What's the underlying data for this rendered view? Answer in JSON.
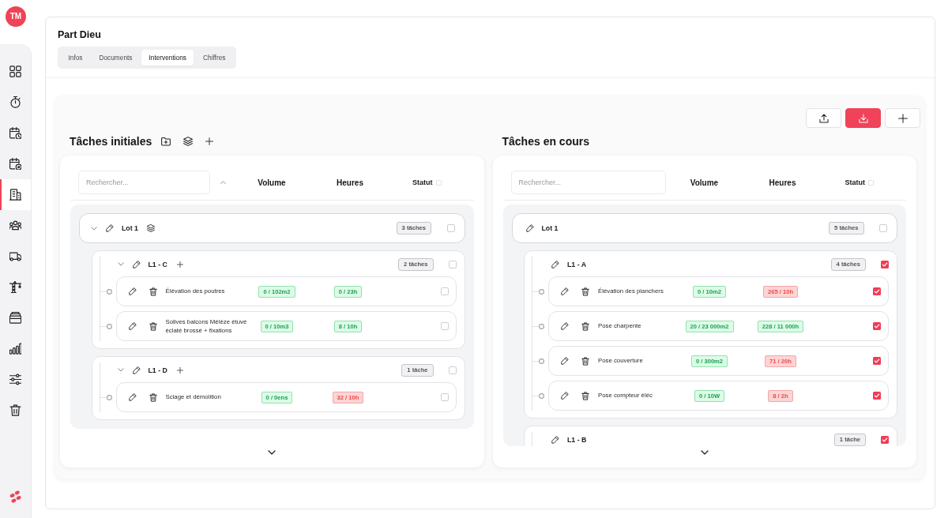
{
  "sidebar": {
    "avatar": "TM",
    "items": [
      {
        "kind": "grid",
        "selected": false
      },
      {
        "kind": "stopwatch",
        "selected": false
      },
      {
        "kind": "calendar-clock",
        "selected": false
      },
      {
        "kind": "calendar-arrow",
        "selected": false
      },
      {
        "kind": "buildings",
        "selected": true
      },
      {
        "kind": "people",
        "selected": false
      },
      {
        "kind": "van",
        "selected": false
      },
      {
        "kind": "crane",
        "selected": false
      },
      {
        "kind": "folders",
        "selected": false
      },
      {
        "kind": "bar-chart",
        "selected": false
      },
      {
        "kind": "sliders",
        "selected": false
      },
      {
        "kind": "trash",
        "selected": false
      }
    ]
  },
  "page": {
    "title": "Part Dieu",
    "tabs": [
      {
        "label": "Infos",
        "selected": false
      },
      {
        "label": "Documents",
        "selected": false
      },
      {
        "label": "Interventions",
        "selected": true
      },
      {
        "label": "Chiffres",
        "selected": false
      }
    ]
  },
  "toolbar": [
    {
      "kind": "upload",
      "primary": false
    },
    {
      "kind": "download",
      "primary": true
    },
    {
      "kind": "add",
      "primary": false
    }
  ],
  "panels": [
    {
      "title": "Tâches initiales",
      "actions": [
        {
          "kind": "folder-add"
        },
        {
          "kind": "layers"
        },
        {
          "kind": "add"
        }
      ],
      "search": {
        "placeholder": "Rechercher..."
      },
      "sort_ascending": true,
      "columns": [
        "Volume",
        "Heures",
        "Statut"
      ],
      "status_checked": false,
      "lots": [
        {
          "name": "Lot 1",
          "count": "3 tâches",
          "expanded": true,
          "layers": true,
          "checked": false,
          "children": [
            {
              "name": "L1 - C",
              "count": "2 tâches",
              "expanded": true,
              "can_add": true,
              "checked": false,
              "children": [
                {
                  "name": "Élévation des poutres",
                  "volume": "0 / 102m2",
                  "volume_over": false,
                  "hours": "0 / 23h",
                  "hours_over": false,
                  "checked": false
                },
                {
                  "name": "Solives balcons Mélèze étuvé éclaté brossé + fixations",
                  "volume": "0 / 10m3",
                  "volume_over": false,
                  "hours": "8 / 10h",
                  "hours_over": false,
                  "checked": false
                }
              ]
            },
            {
              "name": "L1 - D",
              "count": "1 tâche",
              "expanded": true,
              "can_add": true,
              "checked": false,
              "children": [
                {
                  "name": "Sciage et démolition",
                  "volume": "0 / 0ens",
                  "volume_over": false,
                  "hours": "32 / 10h",
                  "hours_over": true,
                  "checked": false
                }
              ]
            }
          ]
        }
      ]
    },
    {
      "title": "Tâches en cours",
      "search": {
        "placeholder": "Rechercher..."
      },
      "columns": [
        "Volume",
        "Heures",
        "Statut"
      ],
      "status_checked": false,
      "lots": [
        {
          "name": "Lot 1",
          "count": "5 tâches",
          "checked": false,
          "children": [
            {
              "name": "L1 - A",
              "count": "4 tâches",
              "checked": true,
              "children": [
                {
                  "name": "Élévation des planchers",
                  "volume": "0 / 10m2",
                  "volume_over": false,
                  "hours": "265 / 10h",
                  "hours_over": true,
                  "checked": true
                },
                {
                  "name": "Pose charpente",
                  "volume": "20 / 23 000m2",
                  "volume_over": false,
                  "hours": "228 / 11 000h",
                  "hours_over": false,
                  "checked": true
                },
                {
                  "name": "Pose couverture",
                  "volume": "0 / 300m2",
                  "volume_over": false,
                  "hours": "71 / 20h",
                  "hours_over": true,
                  "checked": true
                },
                {
                  "name": "Pose compteur éléc",
                  "volume": "0 / 10W",
                  "volume_over": false,
                  "hours": "8 / 2h",
                  "hours_over": true,
                  "checked": true
                }
              ]
            },
            {
              "name": "L1 - B",
              "count": "1 tâche",
              "checked": true
            }
          ]
        }
      ]
    }
  ]
}
